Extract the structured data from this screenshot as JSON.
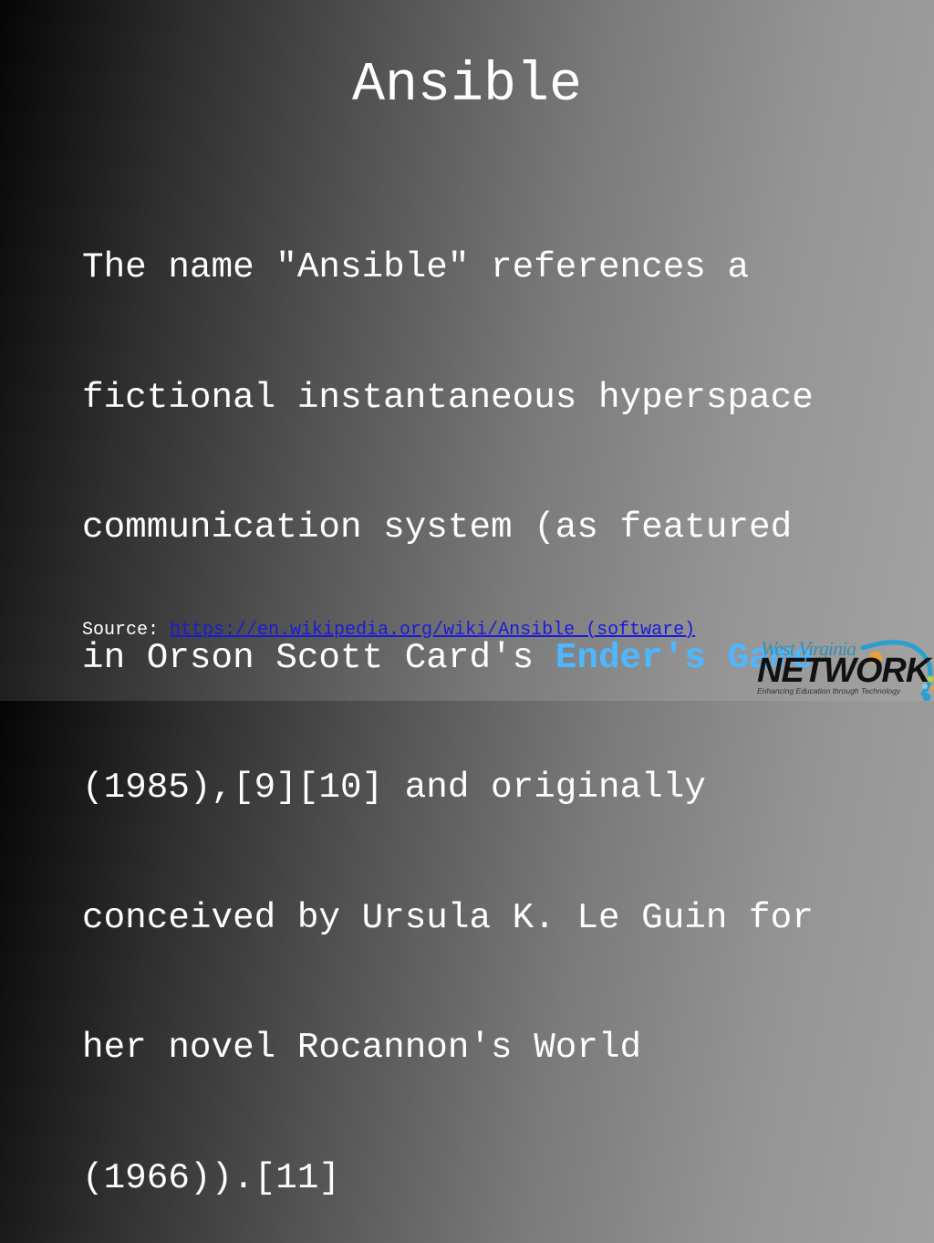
{
  "slide": {
    "title": "Ansible",
    "body_lines": [
      {
        "text": "The name \"Ansible\" references a"
      },
      {
        "text": "fictional instantaneous hyperspace"
      },
      {
        "text": "communication system (as featured"
      },
      {
        "text": "in Orson Scott Card's ",
        "highlight": "Ender's Game"
      },
      {
        "text": "(1985),[9][10] and originally"
      },
      {
        "text": "conceived by Ursula K. Le Guin for"
      },
      {
        "text": "her novel Rocannon's World"
      },
      {
        "text": "(1966)).[11]"
      }
    ],
    "source_label": "Source: ",
    "source_link": "https://en.wikipedia.org/wiki/Ansible_(software)",
    "source_link_text": "https://en.wikipedia.org/wiki/Ansible (software)"
  },
  "logo": {
    "line1": "West Virginia",
    "line2": "NETWORK",
    "tagline": "Enhancing Education through Technology"
  },
  "colors": {
    "text": "#ffffff",
    "highlight": "#4db8ff",
    "link": "#1a1adb",
    "logo_blue": "#3a8fb0",
    "logo_orange": "#f0a030"
  }
}
